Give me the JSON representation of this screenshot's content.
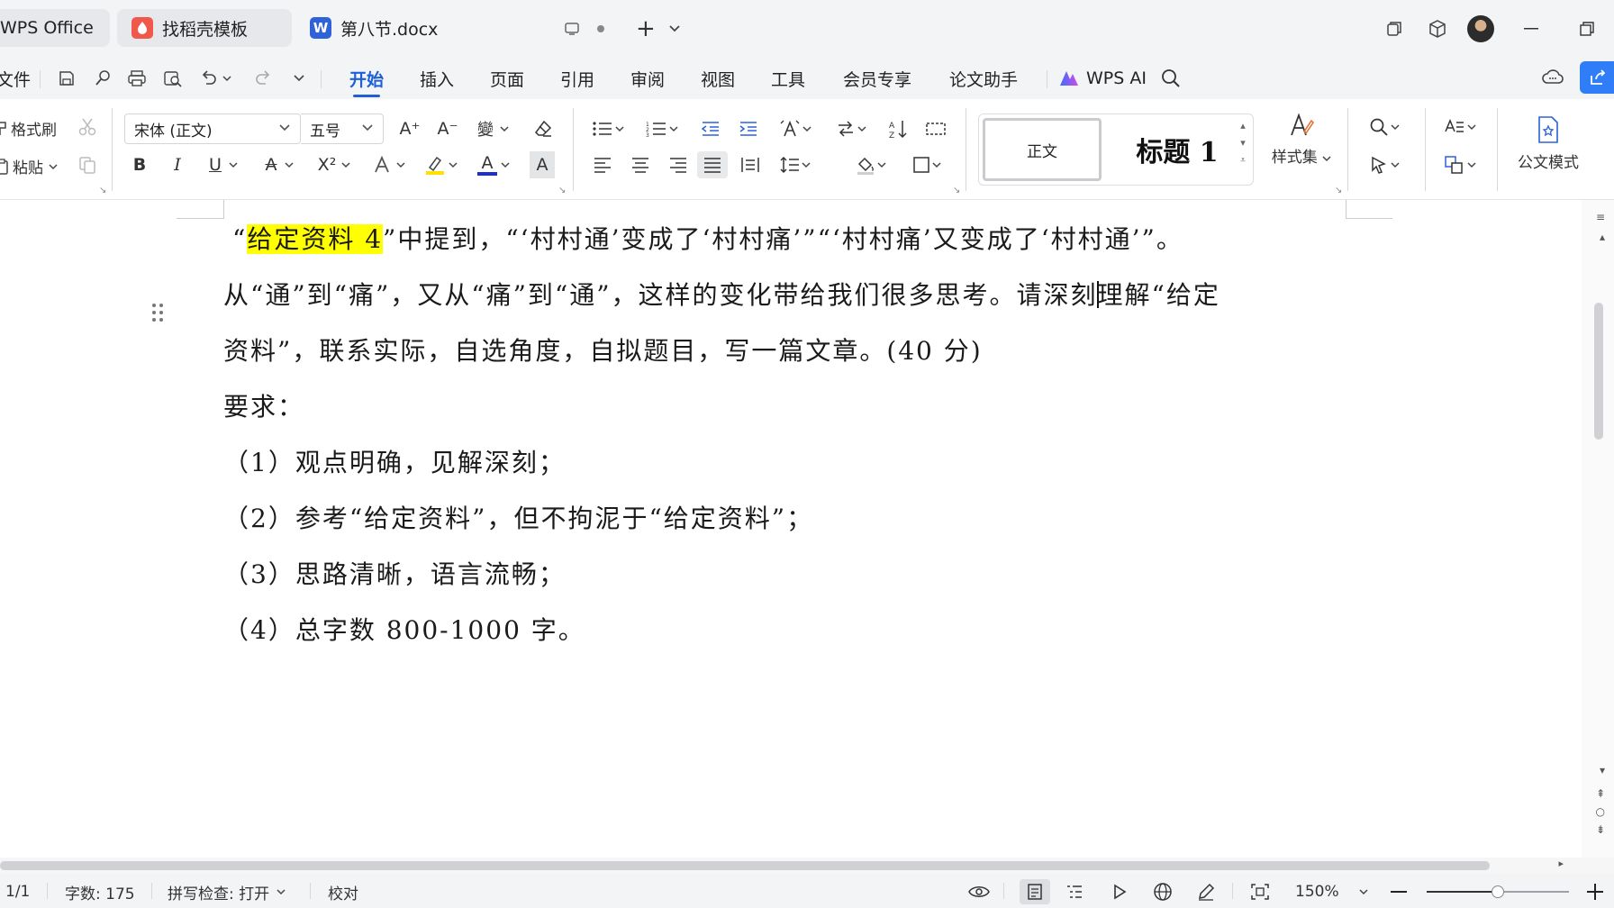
{
  "titlebar": {
    "tabs": [
      {
        "label": "WPS Office",
        "icon": "wps-logo-icon"
      },
      {
        "label": "找稻壳模板",
        "icon": "daoke-icon"
      },
      {
        "label": "第八节.docx",
        "icon": "word-doc-icon"
      }
    ],
    "new_tab_symbol": "+",
    "dropdown_symbol": "⌄"
  },
  "menubar": {
    "file_label": "文件",
    "tabs": [
      "开始",
      "插入",
      "页面",
      "引用",
      "审阅",
      "视图",
      "工具",
      "会员专享",
      "论文助手"
    ],
    "active_tab": "开始",
    "ai_label": "WPS AI"
  },
  "ribbon": {
    "format_painter": "格式刷",
    "paste": "粘贴",
    "font_name": "宋体 (正文)",
    "font_size": "五号",
    "style_normal": "正文",
    "style_heading": "标题 1",
    "style_set": "样式集",
    "official_mode": "公文模式",
    "bold": "B",
    "italic": "I",
    "underline": "U",
    "strike": "A",
    "superscript": "X²",
    "grow": "A⁺",
    "shrink": "A⁻",
    "font_color": "A",
    "char_shading": "A",
    "highlight_color": "#ffe000",
    "font_color_value": "#1e2fd0"
  },
  "document": {
    "line1": {
      "open_quote": "“",
      "highlight": "给定资料 4",
      "rest": "”中提到，“‘村村通’变成了‘村村痛’”“‘村村痛’又变成了‘村村通’”。"
    },
    "line2": {
      "before_caret": "从“通”到“痛”，又从“痛”到“通”，这样的变化带给我们很多思考。请深刻",
      "after_caret": "理解“给定"
    },
    "line3": "资料”，联系实际，自选角度，自拟题目，写一篇文章。(40 分)",
    "line4": "要求：",
    "req1": "（1）观点明确，见解深刻；",
    "req2": "（2）参考“给定资料”，但不拘泥于“给定资料”；",
    "req3": "（3）思路清晰，语言流畅；",
    "req4": "（4）总字数 800-1000 字。",
    "highlight_color": "#ffff00"
  },
  "statusbar": {
    "page": "1/1",
    "word_count": "字数: 175",
    "spellcheck": "拼写检查: 打开",
    "proofread": "校对",
    "zoom": "150%",
    "zoom_level": 0.5
  }
}
